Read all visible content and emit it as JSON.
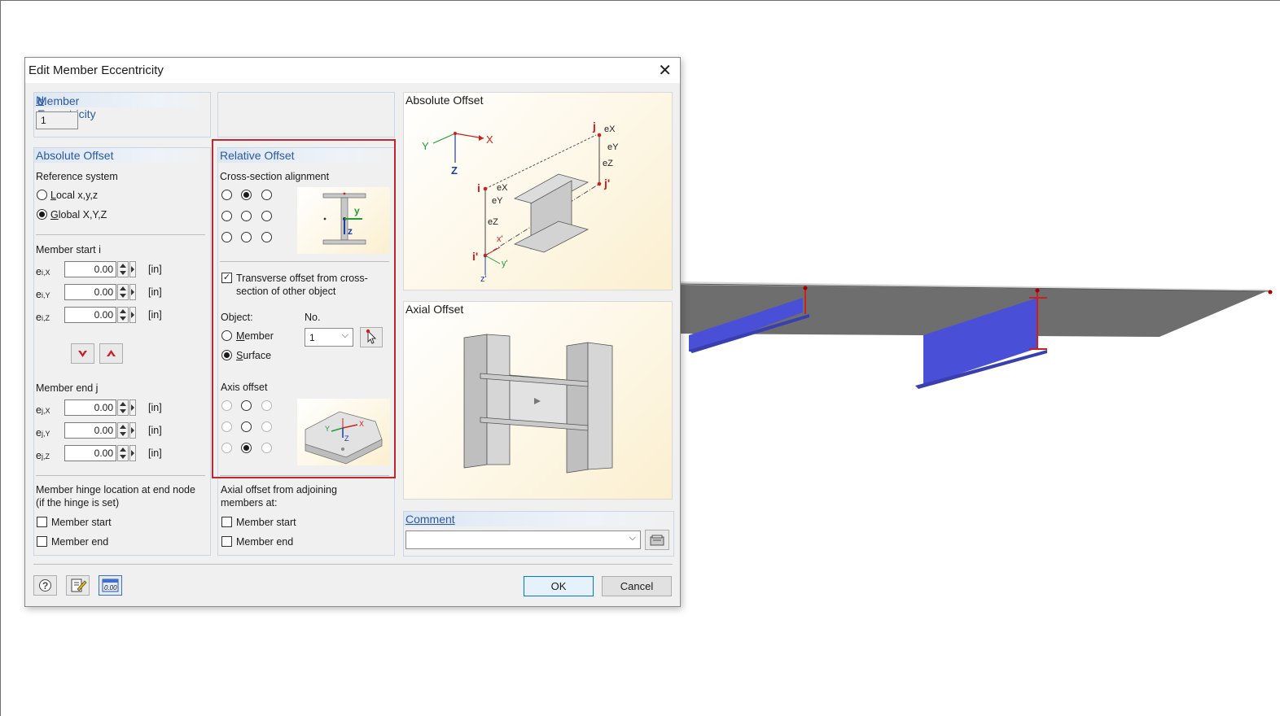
{
  "dialog": {
    "title": "Edit Member Eccentricity",
    "no_group": {
      "label_pre": "Member Eccentricity ",
      "label_u": "N",
      "label_post": "o.",
      "value": "1"
    },
    "absolute_offset": {
      "heading": "Absolute Offset",
      "reference_system_label": "Reference system",
      "options": [
        {
          "label_u": "L",
          "label_rest": "ocal x,y,z",
          "selected": false
        },
        {
          "label_u": "G",
          "label_rest": "lobal X,Y,Z",
          "selected": true
        }
      ],
      "start_label": "Member start i",
      "start_fields": [
        {
          "sym": "e",
          "sub": "i,X",
          "value": "0.00",
          "unit": "[in]"
        },
        {
          "sym": "e",
          "sub": "i,Y",
          "value": "0.00",
          "unit": "[in]"
        },
        {
          "sym": "e",
          "sub": "i,Z",
          "value": "0.00",
          "unit": "[in]"
        }
      ],
      "end_label": "Member end j",
      "end_fields": [
        {
          "sym": "e",
          "sub": "j,X",
          "value": "0.00",
          "unit": "[in]"
        },
        {
          "sym": "e",
          "sub": "j,Y",
          "value": "0.00",
          "unit": "[in]"
        },
        {
          "sym": "e",
          "sub": "j,Z",
          "value": "0.00",
          "unit": "[in]"
        }
      ],
      "hinge_label_1": "Member hinge location at end node",
      "hinge_label_2": "(if the hinge is set)",
      "hinge_start": "Member start",
      "hinge_end": "Member end"
    },
    "relative_offset": {
      "heading": "Relative Offset",
      "alignment_label": "Cross-section alignment",
      "alignment_selected_index": 1,
      "transverse_label_1": "Transverse offset from cross-",
      "transverse_label_2": "section of other object",
      "transverse_checked": true,
      "object_label": "Object:",
      "no_label": "No.",
      "object_options": [
        {
          "label_u": "M",
          "label_rest": "ember",
          "selected": false
        },
        {
          "label_u": "S",
          "label_rest": "urface",
          "selected": true
        }
      ],
      "no_value": "1",
      "axis_offset_label": "Axis offset",
      "axis_selected_index": 7,
      "axial_label_1": "Axial offset from adjoining",
      "axial_label_2": "members at:",
      "axial_start": "Member start",
      "axial_end": "Member end"
    },
    "pictures": {
      "absolute_title": "Absolute Offset",
      "axial_title": "Axial Offset"
    },
    "comment": {
      "heading": "Comment",
      "value": ""
    },
    "buttons": {
      "ok": "OK",
      "cancel": "Cancel"
    },
    "footer_icons": [
      "help-icon",
      "edit-icon",
      "units-icon"
    ],
    "units_icon_text": "0.00",
    "diagram_labels": {
      "X": "X",
      "Y": "Y",
      "Z": "Z",
      "i": "i",
      "j": "j",
      "i_prime": "i'",
      "j_prime": "j'",
      "x_prime": "x'",
      "y_prime": "y'",
      "z_prime": "z'",
      "eX": "eX",
      "eY": "eY",
      "eZ": "eZ",
      "y": "y",
      "z": "z",
      "sect_y": "y",
      "sect_z": "z"
    }
  },
  "accent_colors": {
    "highlight": "#c0282d",
    "member_blue": "#4a4fd8",
    "header_blue": "#2c5aa0"
  }
}
